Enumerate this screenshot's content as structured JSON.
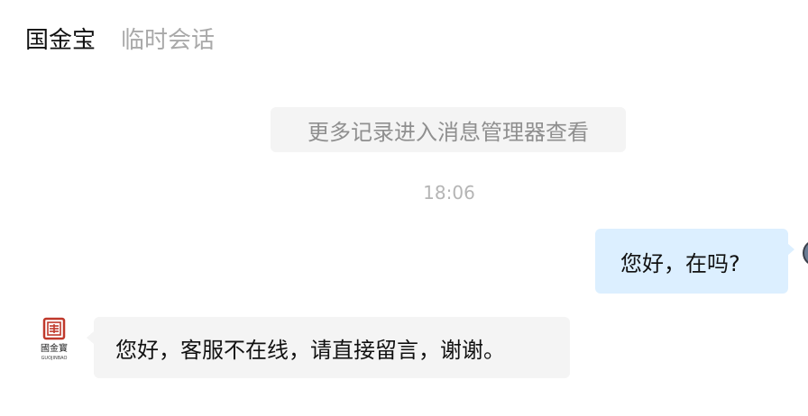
{
  "header": {
    "contact_name": "国金宝",
    "session_type": "临时会话"
  },
  "history": {
    "link_text": "更多记录进入消息管理器查看"
  },
  "messages": {
    "timestamp": "18:06",
    "outgoing": {
      "text": "您好，在吗?"
    },
    "incoming": {
      "text": "您好，客服不在线，请直接留言，谢谢。"
    }
  },
  "avatar": {
    "icon": "guojinbao-logo-icon",
    "logo_text": "國金寳",
    "logo_subtext": "GUOJINBAO",
    "brand_color": "#c0392b"
  },
  "colors": {
    "outgoing_bubble": "#dcefff",
    "incoming_bubble": "#f4f4f4",
    "muted_text": "#a9a9a9"
  }
}
